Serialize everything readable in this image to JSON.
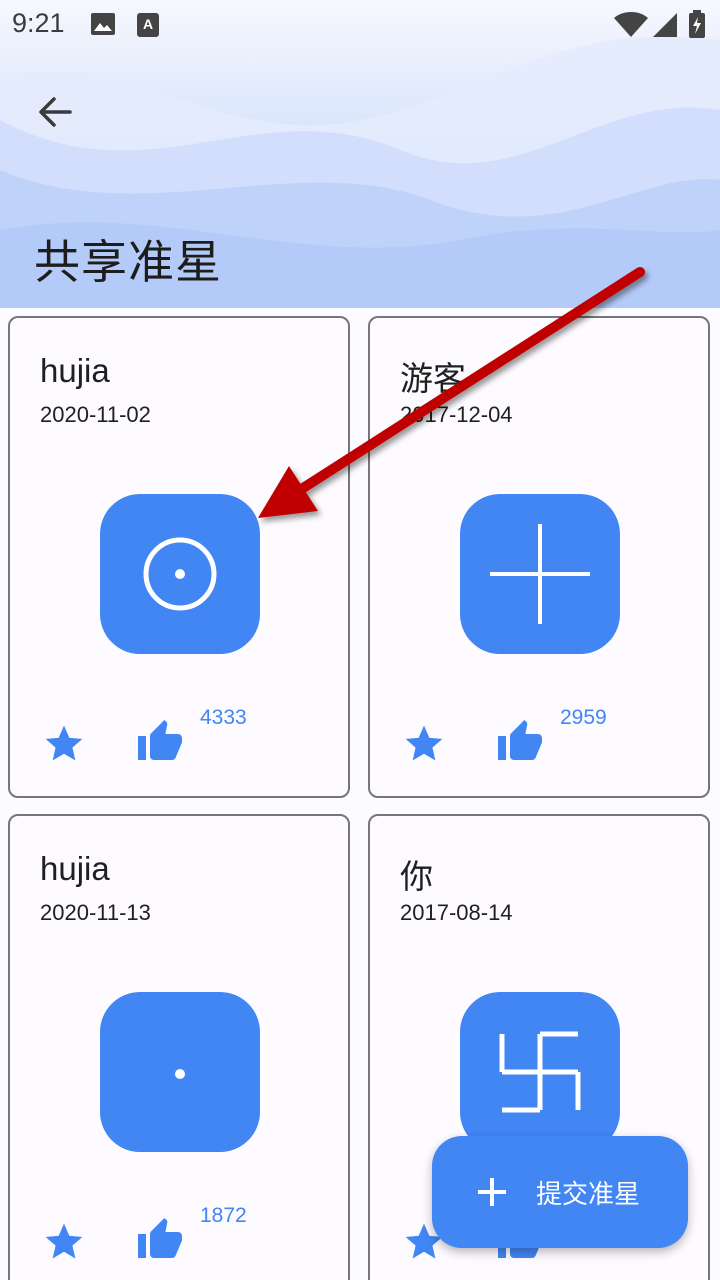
{
  "status_bar": {
    "time": "9:21",
    "icons": [
      "image-icon",
      "a-text-icon",
      "wifi-icon",
      "signal-icon",
      "battery-icon"
    ]
  },
  "header": {
    "back_icon": "arrow-left-icon",
    "title": "共享准星"
  },
  "cards": [
    {
      "name": "hujia",
      "date": "2020-11-02",
      "crosshair": "circle-dot",
      "likes": "4333"
    },
    {
      "name": "游客",
      "date": "2017-12-04",
      "crosshair": "cross",
      "likes": "2959"
    },
    {
      "name": "hujia",
      "date": "2020-11-13",
      "crosshair": "dot",
      "likes": "1872"
    },
    {
      "name": "你",
      "date": "2017-08-14",
      "crosshair": "swastika",
      "likes": ""
    }
  ],
  "fab": {
    "icon": "plus-icon",
    "label": "提交准星"
  },
  "colors": {
    "accent": "#4286f4",
    "card_border": "#77747b",
    "background": "#fcfbff",
    "annotation_arrow": "#c00000"
  }
}
